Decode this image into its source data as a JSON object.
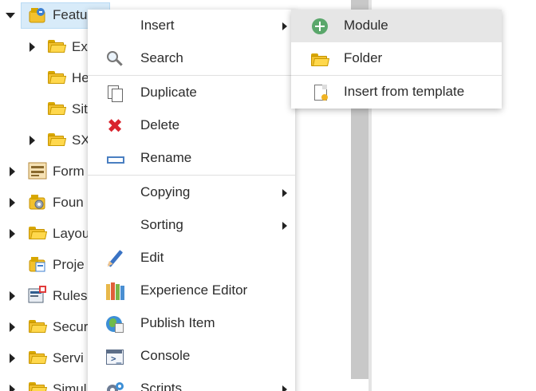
{
  "tree": {
    "items": [
      {
        "label": "Featu",
        "icon": "feature-module-icon",
        "expanded": true,
        "selected": true
      },
      {
        "label": "Ex",
        "icon": "folder-icon"
      },
      {
        "label": "He",
        "icon": "folder-icon"
      },
      {
        "label": "Sit",
        "icon": "folder-icon"
      },
      {
        "label": "SX",
        "icon": "folder-icon"
      },
      {
        "label": "Form",
        "icon": "form-icon"
      },
      {
        "label": "Foun",
        "icon": "foundation-icon"
      },
      {
        "label": "Layou",
        "icon": "folder-icon"
      },
      {
        "label": "Proje",
        "icon": "project-icon"
      },
      {
        "label": "Rules",
        "icon": "rules-icon"
      },
      {
        "label": "Secur",
        "icon": "folder-icon"
      },
      {
        "label": "Servi",
        "icon": "folder-icon"
      },
      {
        "label": "Simul",
        "icon": "folder-icon"
      }
    ]
  },
  "context_menu": {
    "items": [
      {
        "label": "Insert",
        "icon": "",
        "submenu": true
      },
      {
        "label": "Search",
        "icon": "search-icon"
      },
      {
        "label": "Duplicate",
        "icon": "duplicate-icon"
      },
      {
        "label": "Delete",
        "icon": "delete-icon"
      },
      {
        "label": "Rename",
        "icon": "rename-icon"
      },
      {
        "label": "Copying",
        "icon": "",
        "submenu": true
      },
      {
        "label": "Sorting",
        "icon": "",
        "submenu": true
      },
      {
        "label": "Edit",
        "icon": "pencil-icon"
      },
      {
        "label": "Experience Editor",
        "icon": "experience-editor-icon"
      },
      {
        "label": "Publish Item",
        "icon": "publish-icon"
      },
      {
        "label": "Console",
        "icon": "console-icon"
      },
      {
        "label": "Scripts",
        "icon": "scripts-icon",
        "submenu": true
      }
    ]
  },
  "insert_submenu": {
    "items": [
      {
        "label": "Module",
        "icon": "add-module-icon",
        "highlighted": true
      },
      {
        "label": "Folder",
        "icon": "folder-icon"
      },
      {
        "label": "Insert from template",
        "icon": "template-icon"
      }
    ]
  },
  "colors": {
    "selection": "#d8ebf9",
    "hover": "#e6e6e6",
    "delete_red": "#d9232d",
    "add_green": "#5aa76b"
  }
}
